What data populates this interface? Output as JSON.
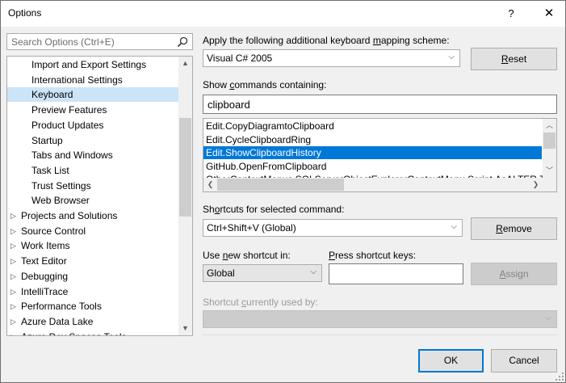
{
  "window": {
    "title": "Options",
    "help_label": "?",
    "close_label": "✕"
  },
  "search": {
    "placeholder": "Search Options (Ctrl+E)",
    "icon": "search-icon"
  },
  "tree": {
    "items": [
      {
        "label": "Import and Export Settings",
        "level": 1,
        "expandable": false,
        "selected": false
      },
      {
        "label": "International Settings",
        "level": 1,
        "expandable": false,
        "selected": false
      },
      {
        "label": "Keyboard",
        "level": 1,
        "expandable": false,
        "selected": true
      },
      {
        "label": "Preview Features",
        "level": 1,
        "expandable": false,
        "selected": false
      },
      {
        "label": "Product Updates",
        "level": 1,
        "expandable": false,
        "selected": false
      },
      {
        "label": "Startup",
        "level": 1,
        "expandable": false,
        "selected": false
      },
      {
        "label": "Tabs and Windows",
        "level": 1,
        "expandable": false,
        "selected": false
      },
      {
        "label": "Task List",
        "level": 1,
        "expandable": false,
        "selected": false
      },
      {
        "label": "Trust Settings",
        "level": 1,
        "expandable": false,
        "selected": false
      },
      {
        "label": "Web Browser",
        "level": 1,
        "expandable": false,
        "selected": false
      },
      {
        "label": "Projects and Solutions",
        "level": 0,
        "expandable": true,
        "selected": false
      },
      {
        "label": "Source Control",
        "level": 0,
        "expandable": true,
        "selected": false
      },
      {
        "label": "Work Items",
        "level": 0,
        "expandable": true,
        "selected": false
      },
      {
        "label": "Text Editor",
        "level": 0,
        "expandable": true,
        "selected": false
      },
      {
        "label": "Debugging",
        "level": 0,
        "expandable": true,
        "selected": false
      },
      {
        "label": "IntelliTrace",
        "level": 0,
        "expandable": true,
        "selected": false
      },
      {
        "label": "Performance Tools",
        "level": 0,
        "expandable": true,
        "selected": false
      },
      {
        "label": "Azure Data Lake",
        "level": 0,
        "expandable": true,
        "selected": false
      },
      {
        "label": "Azure Dev Spaces Tools",
        "level": 0,
        "expandable": true,
        "selected": false
      }
    ]
  },
  "mapping": {
    "label_pre": "Apply the following additional keyboard ",
    "label_u": "m",
    "label_post": "apping scheme:",
    "value": "Visual C# 2005",
    "reset_pre": "",
    "reset_u": "R",
    "reset_post": "eset"
  },
  "commands": {
    "label_pre": "Show ",
    "label_u": "c",
    "label_post": "ommands containing:",
    "filter_value": "clipboard",
    "items": [
      {
        "label": "Edit.CopyDiagramtoClipboard",
        "selected": false
      },
      {
        "label": "Edit.CycleClipboardRing",
        "selected": false
      },
      {
        "label": "Edit.ShowClipboardHistory",
        "selected": true
      },
      {
        "label": "GitHub.OpenFromClipboard",
        "selected": false
      },
      {
        "label": "OtherContextMenus.SQLServerObjectExplorerContextMenu.Script.AsALTER.To.Clipboard",
        "selected": false
      }
    ]
  },
  "shortcuts": {
    "label_pre": "Sh",
    "label_u": "o",
    "label_post": "rtcuts for selected command:",
    "value": "Ctrl+Shift+V (Global)",
    "remove_pre": "",
    "remove_u": "R",
    "remove_post": "emove"
  },
  "new_shortcut": {
    "use_label_pre": "Use ",
    "use_label_u": "n",
    "use_label_post": "ew shortcut in:",
    "scope_value": "Global",
    "press_label_pre": "",
    "press_label_u": "P",
    "press_label_post": "ress shortcut keys:",
    "keys_value": "",
    "assign_label_pre": "",
    "assign_label_u": "A",
    "assign_label_post": "ssign"
  },
  "used_by": {
    "label_pre": "Shortcut ",
    "label_u": "c",
    "label_post": "urrently used by:",
    "value": ""
  },
  "footer": {
    "ok_label": "OK",
    "cancel_label": "Cancel"
  }
}
